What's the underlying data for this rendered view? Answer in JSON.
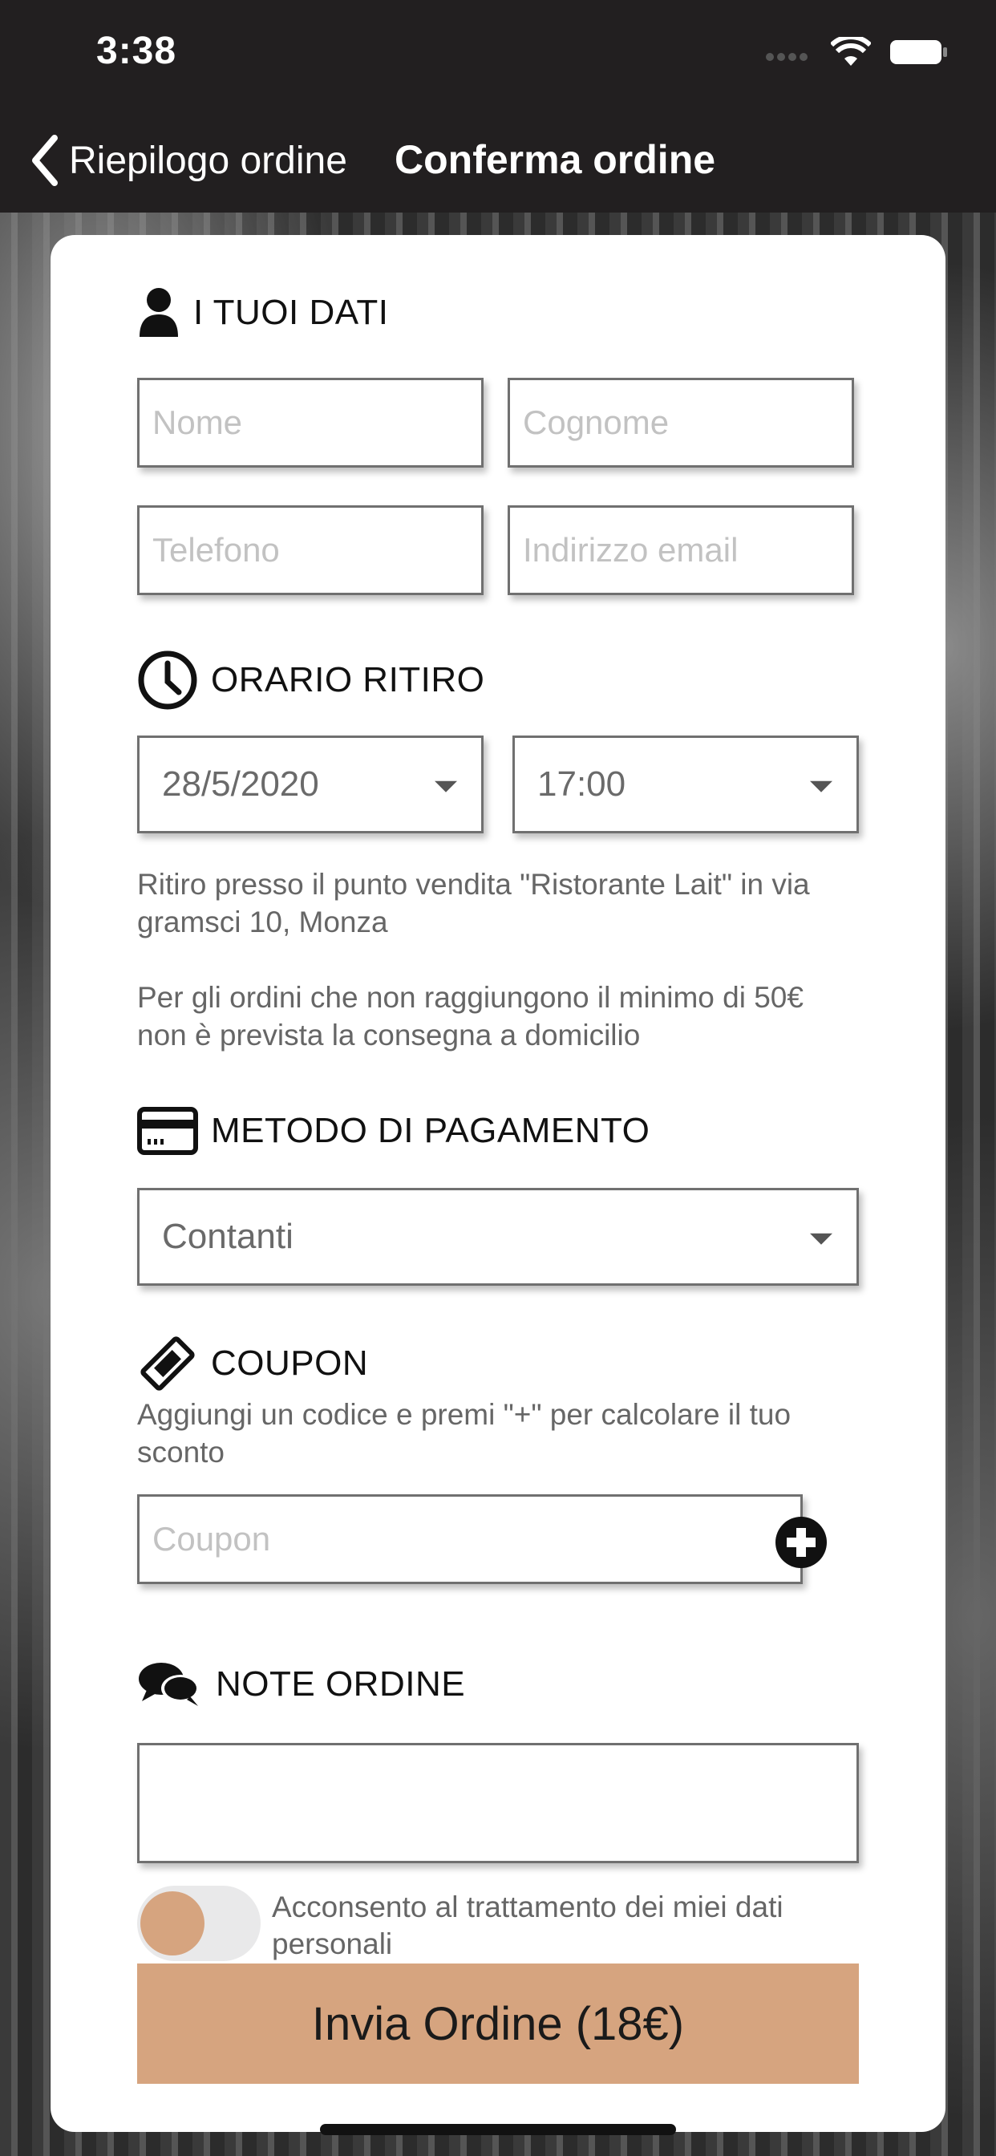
{
  "status_bar": {
    "time": "3:38"
  },
  "nav": {
    "back_label": "Riepilogo ordine",
    "title": "Conferma ordine"
  },
  "sections": {
    "personal": {
      "title": "I TUOI DATI",
      "first_name_placeholder": "Nome",
      "last_name_placeholder": "Cognome",
      "phone_placeholder": "Telefono",
      "email_placeholder": "Indirizzo email"
    },
    "pickup": {
      "title": "ORARIO RITIRO",
      "date": "28/5/2020",
      "time": "17:00",
      "note_location": "Ritiro presso il punto vendita \"Ristorante Lait\" in via gramsci 10, Monza",
      "note_minimum": "Per gli ordini che non raggiungono il minimo di 50€ non è prevista la consegna a domicilio"
    },
    "payment": {
      "title": "METODO DI PAGAMENTO",
      "method": "Contanti"
    },
    "coupon": {
      "title": "COUPON",
      "hint": "Aggiungi un codice e premi \"+\" per calcolare il tuo sconto",
      "placeholder": "Coupon"
    },
    "notes": {
      "title": "NOTE ORDINE",
      "value": ""
    }
  },
  "consent": {
    "label": "Acconsento al trattamento dei miei dati personali",
    "enabled": false
  },
  "submit": {
    "label": "Invia Ordine (18€)"
  },
  "colors": {
    "accent": "#d6a47f",
    "header": "#221f20"
  }
}
